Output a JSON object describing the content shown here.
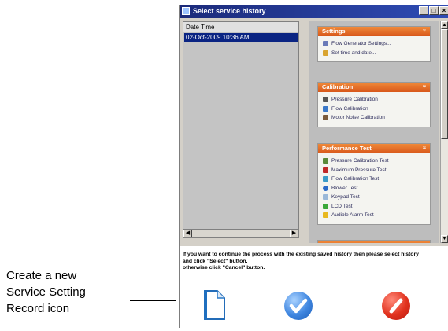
{
  "window": {
    "title": "Select service history"
  },
  "history_list": {
    "header": "Date Time",
    "rows": [
      "02-Oct-2009 10:36 AM"
    ]
  },
  "groups": [
    {
      "title": "Settings",
      "items": [
        "Flow Generator Settings...",
        "Set time and date..."
      ]
    },
    {
      "title": "Calibration",
      "items": [
        "Pressure Calibration",
        "Flow Calibration",
        "Motor Noise Calibration"
      ]
    },
    {
      "title": "Performance Test",
      "items": [
        "Pressure Calibration Test",
        "Maximum Pressure Test",
        "Flow Calibration Test",
        "Blower Test",
        "Keypad Test",
        "LCD Test",
        "Audible Alarm Test"
      ]
    }
  ],
  "message": {
    "line1": "If you want to continue the process with the existing saved history then please select history",
    "line2": "and click \"Select\" button,",
    "line3": "otherwise click \"Cancel\" button."
  },
  "callout": {
    "line1": "Create a new",
    "line2": "Service Setting",
    "line3": "Record icon"
  },
  "colors": {
    "title_bar": "#1b2a7a",
    "selection": "#0a2483",
    "group_header": "#e06a26",
    "select_button": "#3f86e0",
    "cancel_button": "#e1321e"
  }
}
